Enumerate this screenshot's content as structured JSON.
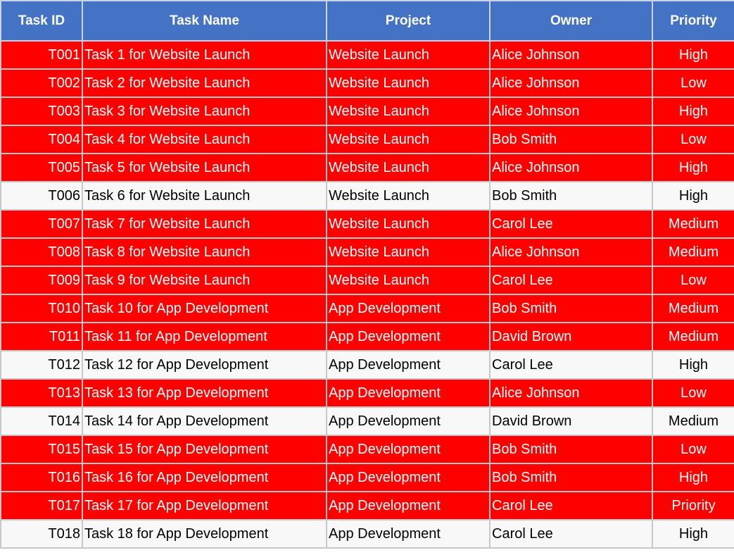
{
  "columns": [
    "Task ID",
    "Task Name",
    "Project",
    "Owner",
    "Priority"
  ],
  "colors": {
    "header_bg": "#4472c4",
    "highlight_bg": "#ff0000",
    "highlight_text": "#ffffff",
    "normal_bg": "#f8f8f8"
  },
  "rows": [
    {
      "id": "T001",
      "name": "Task 1 for Website Launch",
      "project": "Website Launch",
      "owner": "Alice Johnson",
      "priority": "High",
      "highlight": true
    },
    {
      "id": "T002",
      "name": "Task 2 for Website Launch",
      "project": "Website Launch",
      "owner": "Alice Johnson",
      "priority": "Low",
      "highlight": true
    },
    {
      "id": "T003",
      "name": "Task 3 for Website Launch",
      "project": "Website Launch",
      "owner": "Alice Johnson",
      "priority": "High",
      "highlight": true
    },
    {
      "id": "T004",
      "name": "Task 4 for Website Launch",
      "project": "Website Launch",
      "owner": "Bob Smith",
      "priority": "Low",
      "highlight": true
    },
    {
      "id": "T005",
      "name": "Task 5 for Website Launch",
      "project": "Website Launch",
      "owner": "Alice Johnson",
      "priority": "High",
      "highlight": true
    },
    {
      "id": "T006",
      "name": "Task 6 for Website Launch",
      "project": "Website Launch",
      "owner": "Bob Smith",
      "priority": "High",
      "highlight": false
    },
    {
      "id": "T007",
      "name": "Task 7 for Website Launch",
      "project": "Website Launch",
      "owner": "Carol Lee",
      "priority": "Medium",
      "highlight": true
    },
    {
      "id": "T008",
      "name": "Task 8 for Website Launch",
      "project": "Website Launch",
      "owner": "Alice Johnson",
      "priority": "Medium",
      "highlight": true
    },
    {
      "id": "T009",
      "name": "Task 9 for Website Launch",
      "project": "Website Launch",
      "owner": "Carol Lee",
      "priority": "Low",
      "highlight": true
    },
    {
      "id": "T010",
      "name": "Task 10 for App Development",
      "project": "App Development",
      "owner": "Bob Smith",
      "priority": "Medium",
      "highlight": true
    },
    {
      "id": "T011",
      "name": "Task 11 for App Development",
      "project": "App Development",
      "owner": "David Brown",
      "priority": "Medium",
      "highlight": true
    },
    {
      "id": "T012",
      "name": "Task 12 for App Development",
      "project": "App Development",
      "owner": "Carol Lee",
      "priority": "High",
      "highlight": false
    },
    {
      "id": "T013",
      "name": "Task 13 for App Development",
      "project": "App Development",
      "owner": "Alice Johnson",
      "priority": "Low",
      "highlight": true
    },
    {
      "id": "T014",
      "name": "Task 14 for App Development",
      "project": "App Development",
      "owner": "David Brown",
      "priority": "Medium",
      "highlight": false
    },
    {
      "id": "T015",
      "name": "Task 15 for App Development",
      "project": "App Development",
      "owner": "Bob Smith",
      "priority": "Low",
      "highlight": true
    },
    {
      "id": "T016",
      "name": "Task 16 for App Development",
      "project": "App Development",
      "owner": "Bob Smith",
      "priority": "High",
      "highlight": true
    },
    {
      "id": "T017",
      "name": "Task 17 for App Development",
      "project": "App Development",
      "owner": "Carol Lee",
      "priority": "Priority",
      "highlight": true
    },
    {
      "id": "T018",
      "name": "Task 18 for App Development",
      "project": "App Development",
      "owner": "Carol Lee",
      "priority": "High",
      "highlight": false
    }
  ]
}
